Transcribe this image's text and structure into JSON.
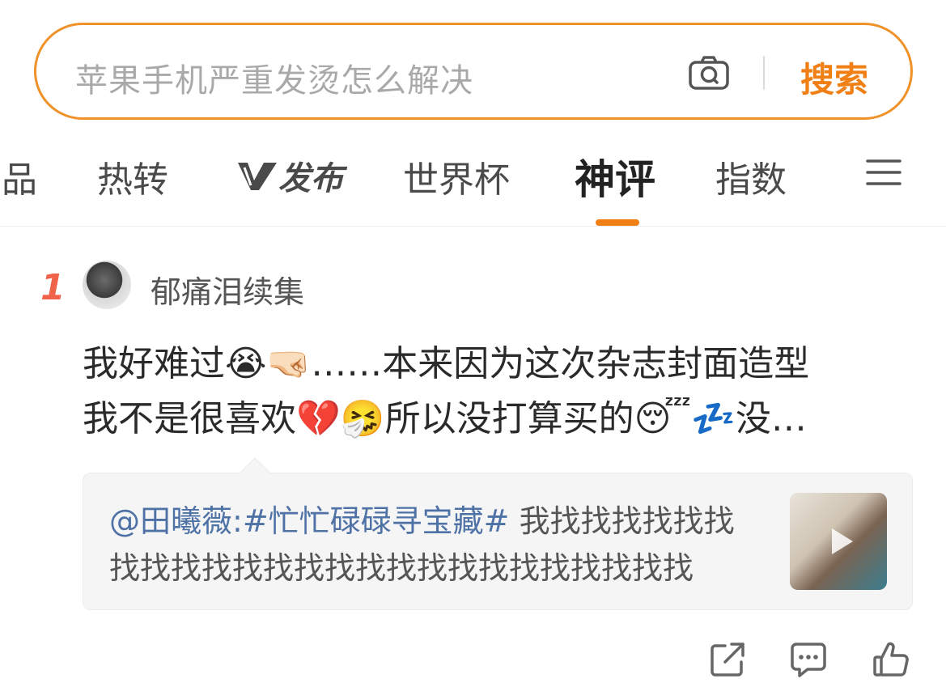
{
  "search": {
    "placeholder": "苹果手机严重发烫怎么解决",
    "button_label": "搜索",
    "camera_icon": "camera-icon"
  },
  "tabs": [
    {
      "label": "品"
    },
    {
      "label": "热转"
    },
    {
      "label": "发布",
      "icon": "v-logo-icon"
    },
    {
      "label": "世界杯"
    },
    {
      "label": "神评",
      "active": true
    },
    {
      "label": "指数"
    }
  ],
  "menu_icon": "menu-icon",
  "accent_color": "#f07f16",
  "comment": {
    "rank": "1",
    "username": "郁痛泪续集",
    "line1": "我好难过😭🤜🏻……本来因为这次杂志封面造型",
    "line2": "我不是很喜欢💔🤧所以没打算买的😴💤没…"
  },
  "quote": {
    "mention": "@田曦薇:",
    "hashtag": "#忙忙碌碌寻宝藏#",
    "text_rest": " 我找找找找找找找找找找找找找找找找找找找找找找找找找"
  },
  "actions": [
    "share-icon",
    "comment-icon",
    "like-icon"
  ]
}
